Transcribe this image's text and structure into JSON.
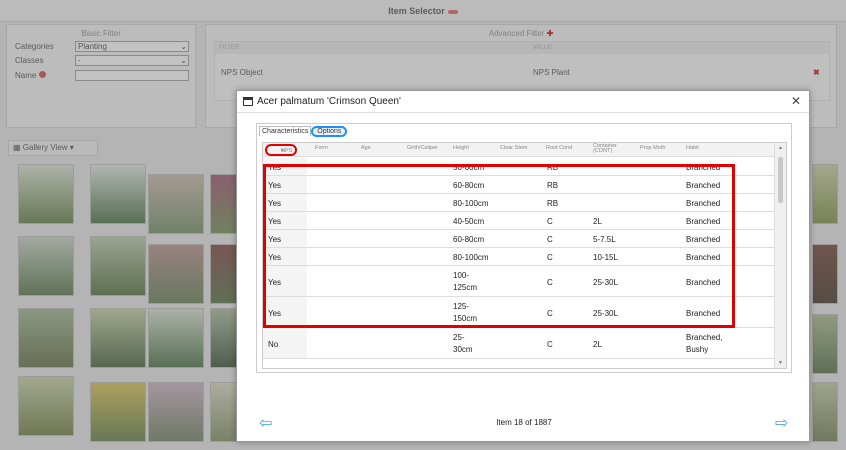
{
  "window": {
    "title": "Item Selector"
  },
  "basic_filter": {
    "heading": "Basic Filter",
    "categories_label": "Categories",
    "categories_value": "Planting",
    "classes_label": "Classes",
    "classes_value": "-",
    "name_label": "Name"
  },
  "advanced_filter": {
    "heading": "Advanced Filter",
    "col_filter": "FILTER",
    "col_value": "VALUE",
    "row_filter": "NPS Object",
    "row_value": "NPS Plant"
  },
  "gallery": {
    "label": "Gallery View"
  },
  "modal": {
    "title": "Acer palmatum 'Crimson Queen'",
    "tabs": [
      "Characteristics",
      "Options"
    ],
    "columns": [
      "NPS",
      "Form",
      "Age",
      "Girth/Caliper",
      "Height",
      "Clear Stem",
      "Root Cond",
      "Container (CONT)",
      "Prop Meth",
      "Habit"
    ],
    "rows": [
      {
        "nps": "Yes",
        "height": "50-60cm",
        "root": "RB",
        "cont": "",
        "habit": "Branched"
      },
      {
        "nps": "Yes",
        "height": "60-80cm",
        "root": "RB",
        "cont": "",
        "habit": "Branched"
      },
      {
        "nps": "Yes",
        "height": "80-100cm",
        "root": "RB",
        "cont": "",
        "habit": "Branched"
      },
      {
        "nps": "Yes",
        "height": "40-50cm",
        "root": "C",
        "cont": "2L",
        "habit": "Branched"
      },
      {
        "nps": "Yes",
        "height": "60-80cm",
        "root": "C",
        "cont": "5-7.5L",
        "habit": "Branched"
      },
      {
        "nps": "Yes",
        "height": "80-100cm",
        "root": "C",
        "cont": "10-15L",
        "habit": "Branched"
      },
      {
        "nps": "Yes",
        "height": "100-125cm",
        "root": "C",
        "cont": "25-30L",
        "habit": "Branched"
      },
      {
        "nps": "Yes",
        "height": "125-150cm",
        "root": "C",
        "cont": "25-30L",
        "habit": "Branched"
      },
      {
        "nps": "No",
        "height": "25-30cm",
        "root": "C",
        "cont": "2L",
        "habit": "Branched, Bushy"
      }
    ],
    "pager": "Item 18 of 1887"
  },
  "colors": {
    "highlight_red": "#e00000",
    "highlight_blue": "#1e90ff",
    "arrow": "#4aa6d8"
  },
  "icons": {
    "close": "close-icon",
    "prev": "arrow-left-icon",
    "next": "arrow-right-icon",
    "grid": "grid-icon"
  }
}
